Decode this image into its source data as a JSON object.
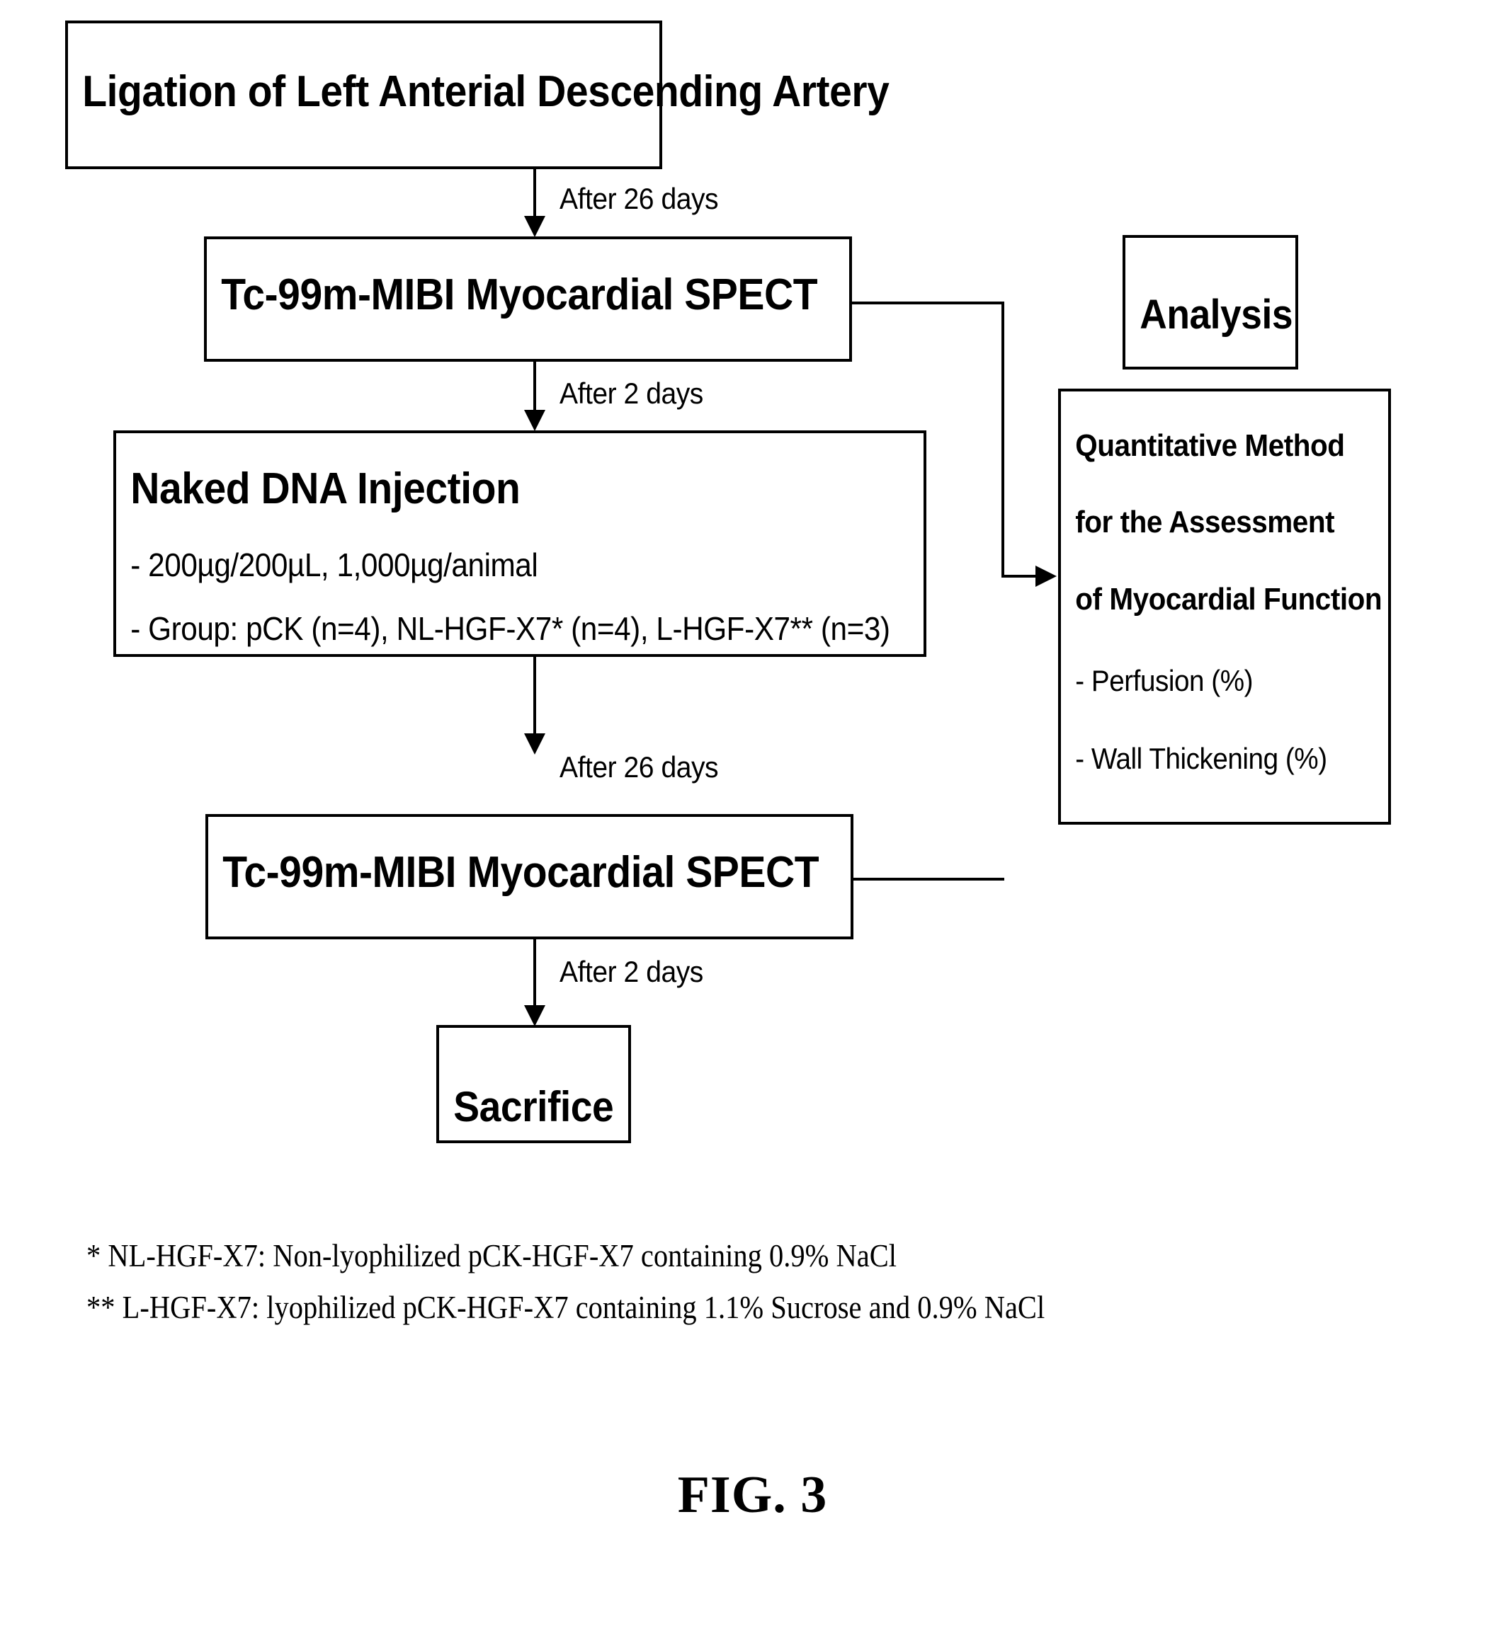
{
  "figure": {
    "caption": "FIG. 3",
    "type": "experimental-workflow-flowchart"
  },
  "nodes": {
    "ligation": {
      "label": "Ligation of Left Anterial Descending Artery"
    },
    "spect_first": {
      "label": "Tc-99m-MIBI Myocardial SPECT"
    },
    "naked_dna": {
      "title": "Naked DNA Injection",
      "bullet1": "- 200µg/200µL, 1,000µg/animal",
      "bullet2": "- Group: pCK (n=4), NL-HGF-X7* (n=4), L-HGF-X7** (n=3)"
    },
    "spect_second": {
      "label": "Tc-99m-MIBI Myocardial SPECT"
    },
    "sacrifice": {
      "label": "Sacrifice"
    },
    "analysis": {
      "label": "Analysis"
    },
    "quantitative": {
      "line1": "Quantitative Method",
      "line2": "for the Assessment",
      "line3": "of Myocardial Function",
      "bullet1": "- Perfusion (%)",
      "bullet2": "- Wall Thickening (%)"
    }
  },
  "edges": {
    "ligation_to_spect1": "After 26 days",
    "spect1_to_dna": "After 2 days",
    "dna_to_spect2": "After 26 days",
    "spect2_to_sacrifice": "After 2 days"
  },
  "footnotes": {
    "line1": "* NL-HGF-X7: Non-lyophilized pCK-HGF-X7 containing 0.9% NaCl",
    "line2": "** L-HGF-X7: lyophilized pCK-HGF-X7 containing 1.1% Sucrose and 0.9% NaCl"
  },
  "colors": {
    "ink": "#000000",
    "paper": "#ffffff"
  }
}
